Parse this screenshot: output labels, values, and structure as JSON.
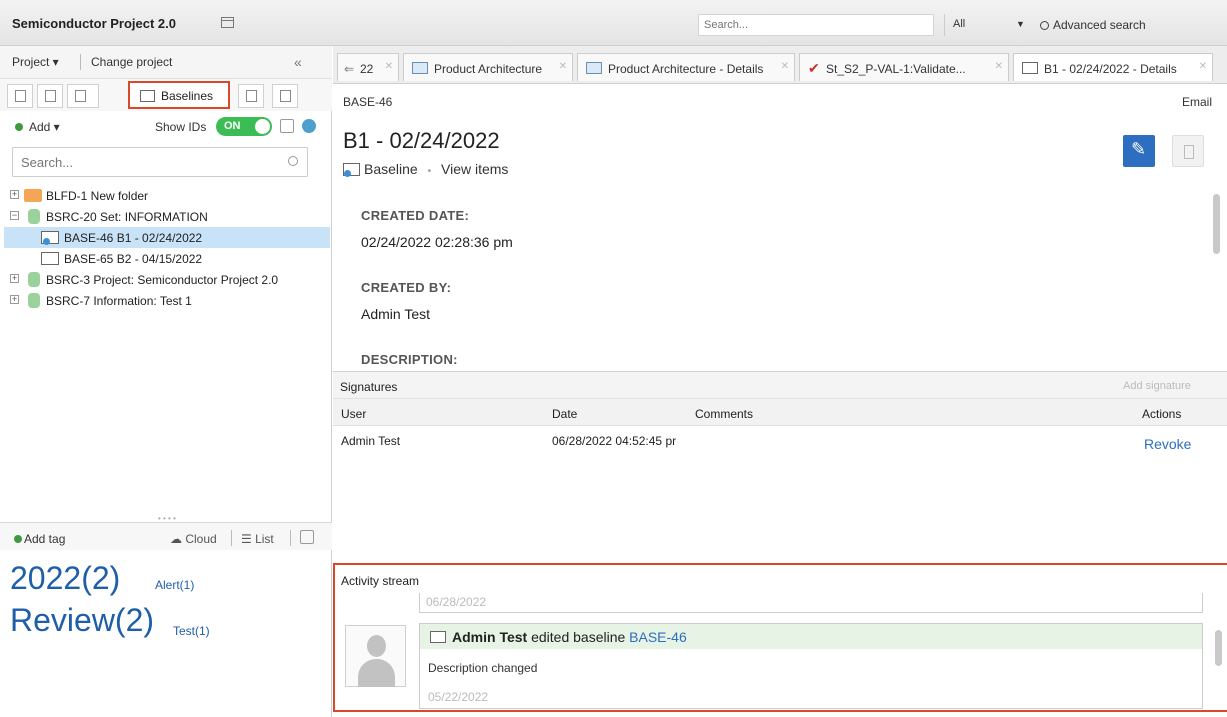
{
  "app": {
    "title": "Semiconductor Project 2.0"
  },
  "topbar": {
    "search_placeholder": "Search...",
    "scope": "All",
    "advanced_search": "Advanced search"
  },
  "left": {
    "project_menu": "Project ▾",
    "change_project": "Change project",
    "collapse": "«",
    "active_tab": "Baselines",
    "add_label": "Add ▾",
    "show_ids_label": "Show IDs",
    "show_ids_state": "ON",
    "search_placeholder": "Search...",
    "tree": [
      {
        "label": "BLFD-1 New folder",
        "expander": "+"
      },
      {
        "label": "BSRC-20 Set: INFORMATION",
        "expander": "−"
      },
      {
        "label": "BASE-46 B1 - 02/24/2022",
        "selected": true
      },
      {
        "label": "BASE-65 B2 - 04/15/2022"
      },
      {
        "label": "BSRC-3 Project: Semiconductor Project 2.0",
        "expander": "+"
      },
      {
        "label": "BSRC-7 Information: Test 1",
        "expander": "+"
      }
    ],
    "tags_toolbar": {
      "add_tag": "Add tag",
      "cloud": "Cloud",
      "list": "List"
    },
    "tags": [
      {
        "label": "2022(2)"
      },
      {
        "label": "Alert(1)"
      },
      {
        "label": "Review(2)"
      },
      {
        "label": "Test(1)"
      }
    ]
  },
  "tabs": [
    {
      "label": "22"
    },
    {
      "label": "Product Architecture"
    },
    {
      "label": "Product Architecture - Details"
    },
    {
      "label": "St_S2_P-VAL-1:Validate..."
    },
    {
      "label": "B1 - 02/24/2022 - Details",
      "active": true
    }
  ],
  "detail": {
    "id": "BASE-46",
    "email": "Email",
    "title": "B1 - 02/24/2022",
    "type_label": "Baseline",
    "separator": "•",
    "view_items": "View items",
    "fields": [
      {
        "label": "CREATED DATE:",
        "value": "02/24/2022 02:28:36 pm"
      },
      {
        "label": "CREATED BY:",
        "value": "Admin Test"
      },
      {
        "label": "DESCRIPTION:",
        "value": ""
      }
    ]
  },
  "signatures": {
    "title": "Signatures",
    "add_signature": "Add signature",
    "columns": [
      "User",
      "Date",
      "Comments",
      "Actions"
    ],
    "rows": [
      {
        "user": "Admin Test",
        "date": "06/28/2022 04:52:45 pr",
        "comments": "",
        "action": "Revoke"
      }
    ]
  },
  "activity": {
    "title": "Activity stream",
    "date_top": "06/28/2022",
    "entry": {
      "user": "Admin Test",
      "action_text": "edited baseline",
      "target": "BASE-46",
      "description": "Description changed",
      "date": "05/22/2022"
    }
  },
  "colors": {
    "accent": "#2e6ec0",
    "highlight_border": "#d9482b",
    "toggle_on": "#3cbc55",
    "selection": "#c8e2f7"
  }
}
